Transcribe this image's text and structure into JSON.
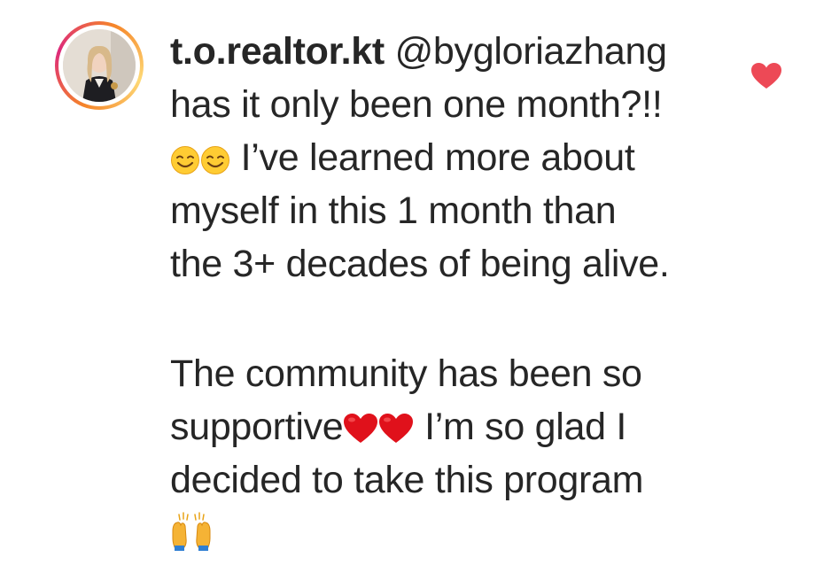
{
  "comment": {
    "username": "t.o.realtor.kt",
    "mention": "@bygloriazhang",
    "line1": "has it only been one month?!!",
    "line2": "I’ve learned more about",
    "line3": "myself in this 1 month than",
    "line4": "the 3+ decades of being alive.",
    "line5": "The community has been so",
    "line6a": "supportive",
    "line6b": "I’m so glad I",
    "line7": "decided to take this program",
    "emojis": [
      "relieved-face-icon",
      "relieved-face-icon",
      "red-heart-icon",
      "red-heart-icon",
      "raising-hands-icon"
    ],
    "liked": true
  },
  "colors": {
    "text": "#262626",
    "like_heart": "#ed4956",
    "emoji_heart": "#e0111b",
    "emoji_face": "#ffcc33",
    "emoji_hands": "#f5b335"
  }
}
